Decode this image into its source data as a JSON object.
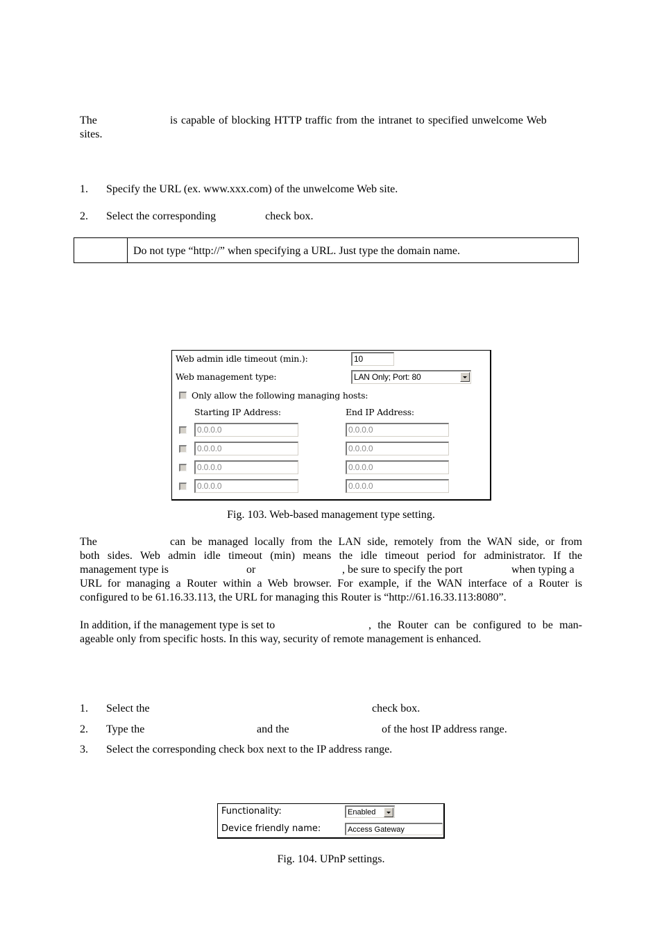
{
  "intro": {
    "p1_start": "The",
    "p1_end": "is capable of blocking HTTP traffic from the intranet to specified unwelcome Web sites."
  },
  "block_steps": [
    {
      "num": "1.",
      "text": "Specify the URL (ex. www.xxx.com) of the unwelcome Web site."
    },
    {
      "num": "2.",
      "text_a": "Select the corresponding",
      "text_b": "check box."
    }
  ],
  "note": {
    "text": "Do not type “http://” when specifying a URL. Just type the domain name."
  },
  "fig103": {
    "idle_timeout_label": "Web admin idle timeout (min.):",
    "idle_timeout_value": "10",
    "mgmt_type_label": "Web management type:",
    "mgmt_type_value": "LAN Only; Port: 80",
    "allow_hosts_label": "Only allow the following managing hosts:",
    "start_ip_header": "Starting IP Address:",
    "end_ip_header": "End IP Address:",
    "rows": [
      {
        "start": "0.0.0.0",
        "end": "0.0.0.0",
        "checked": false
      },
      {
        "start": "0.0.0.0",
        "end": "0.0.0.0",
        "checked": false
      },
      {
        "start": "0.0.0.0",
        "end": "0.0.0.0",
        "checked": false
      },
      {
        "start": "0.0.0.0",
        "end": "0.0.0.0",
        "checked": false
      }
    ],
    "caption": "Fig. 103. Web-based management type setting."
  },
  "mgmt_para": {
    "l1_a": "The",
    "l1_b": "can be managed locally from the LAN side, remotely from the WAN side, or from",
    "l2": "both sides. Web admin idle timeout (min) means the idle timeout period for administrator. If the",
    "l3_a": "management type is",
    "l3_b": "or",
    "l3_c": ", be sure to specify the port",
    "l3_d": "when typing a",
    "l4": "URL for managing a Router within a Web browser. For example, if the WAN interface of a Router is",
    "l5": "configured to be 61.16.33.113, the URL for managing this Router is “http://61.16.33.113:8080”."
  },
  "addition_para": {
    "l1_a": "In addition, if the management type is set to",
    "l1_b": ", the Router can be configured to be man-",
    "l2": "ageable only from specific hosts. In this way, security of remote management is enhanced."
  },
  "host_steps": [
    {
      "num": "1.",
      "text_a": "Select the",
      "text_b": "check box."
    },
    {
      "num": "2.",
      "text_a": "Type the",
      "text_b": "and the",
      "text_c": "of the host IP address range."
    },
    {
      "num": "3.",
      "text_a": "Select the corresponding check box next to the IP address range."
    }
  ],
  "fig104": {
    "functionality_label": "Functionality:",
    "functionality_value": "Enabled",
    "device_name_label": "Device friendly name:",
    "device_name_value": "Access Gateway",
    "caption": "Fig. 104. UPnP settings."
  }
}
